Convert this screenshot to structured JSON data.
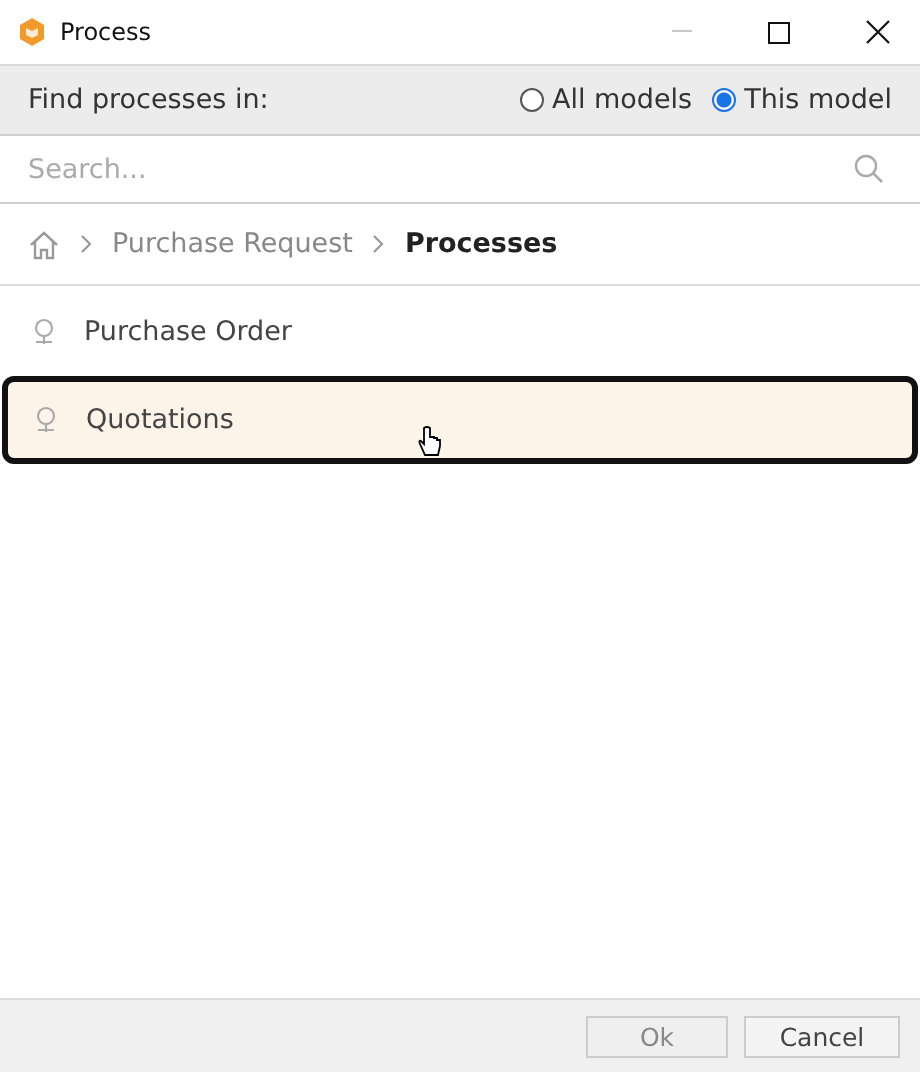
{
  "window": {
    "title": "Process"
  },
  "filter": {
    "label": "Find processes in:",
    "options": [
      {
        "label": "All models",
        "selected": false
      },
      {
        "label": "This model",
        "selected": true
      }
    ]
  },
  "search": {
    "placeholder": "Search..."
  },
  "breadcrumb": [
    {
      "label": "Purchase Request",
      "current": false
    },
    {
      "label": "Processes",
      "current": true
    }
  ],
  "items": [
    {
      "label": "Purchase Order",
      "selected": false
    },
    {
      "label": "Quotations",
      "selected": true
    }
  ],
  "buttons": [
    {
      "label": "Ok",
      "disabled": true
    },
    {
      "label": "Cancel",
      "disabled": false
    }
  ]
}
